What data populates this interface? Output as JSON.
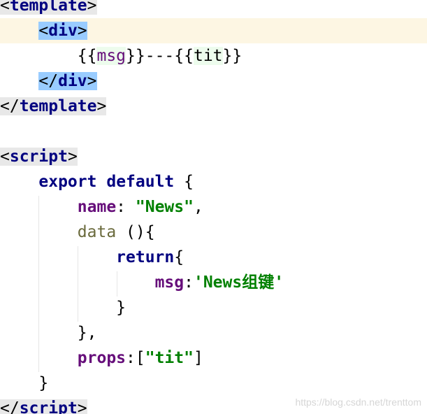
{
  "code_lines": {
    "l1": {
      "open": "<",
      "tag": "template",
      "close": ">"
    },
    "l2": {
      "open": "<",
      "tag": "div",
      "close": ">"
    },
    "l3": {
      "open1": "{{",
      "var1": "msg",
      "mid": "}}---{{",
      "var2": "tit",
      "close2": "}}"
    },
    "l4": {
      "open": "</",
      "tag": "div",
      "close": ">"
    },
    "l5": {
      "open": "</",
      "tag": "template",
      "close": ">"
    },
    "l7": {
      "open": "<",
      "tag": "script",
      "close": ">"
    },
    "l8": {
      "kw1": "export",
      "kw2": "default",
      "rest": " {"
    },
    "l9": {
      "prop": "name",
      "colon": ": ",
      "str": "\"News\"",
      "rest": ","
    },
    "l10": {
      "fn": "data",
      "rest": " (){"
    },
    "l11": {
      "kw": "return",
      "rest": "{"
    },
    "l12": {
      "prop": "msg",
      "colon": ":",
      "str": "'News组键'"
    },
    "l13": {
      "text": "}"
    },
    "l14": {
      "text": "},"
    },
    "l15": {
      "prop": "props",
      "colon": ":[",
      "str": "\"tit\"",
      "rest": "]"
    },
    "l16": {
      "text": "}"
    },
    "l17": {
      "open": "</",
      "tag": "script",
      "close": ">"
    }
  },
  "colors": {
    "keyword": "#000080",
    "property": "#660e7a",
    "string": "#008000",
    "function": "#6a6a3c",
    "current_line": "#fdf6e3",
    "tag_match": "#99ccff"
  },
  "watermark": "https://blog.csdn.net/trenttom"
}
